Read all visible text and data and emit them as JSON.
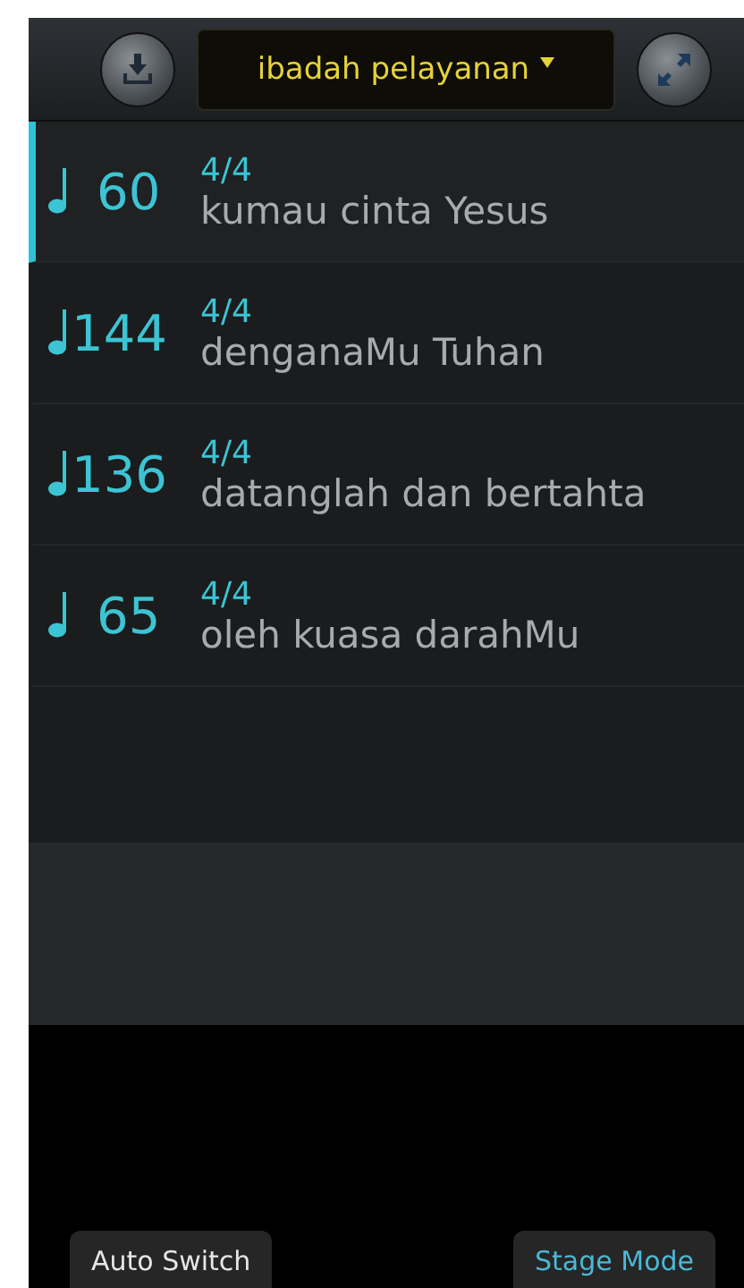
{
  "header": {
    "playlist": "ibadah pelayanan"
  },
  "songs": [
    {
      "tempo": "60",
      "meter": "4/4",
      "title": "kumau cinta Yesus",
      "selected": true
    },
    {
      "tempo": "144",
      "meter": "4/4",
      "title": "denganaMu Tuhan",
      "selected": false
    },
    {
      "tempo": "136",
      "meter": "4/4",
      "title": "datanglah dan bertahta",
      "selected": false
    },
    {
      "tempo": "65",
      "meter": "4/4",
      "title": "oleh kuasa darahMu",
      "selected": false
    }
  ],
  "buttons": [
    {
      "label": "Auto Switch",
      "active": false
    },
    {
      "label": "Stage Mode",
      "active": true
    }
  ]
}
